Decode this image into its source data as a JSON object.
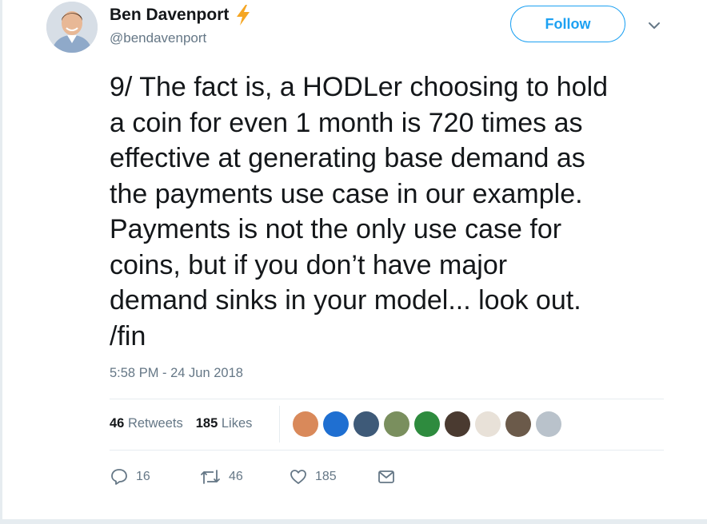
{
  "author": {
    "name": "Ben Davenport",
    "handle": "@bendavenport",
    "badge_icon": "lightning-bolt-icon",
    "badge_color": "#f5a623"
  },
  "header": {
    "follow_label": "Follow",
    "menu_icon": "chevron-down-icon"
  },
  "tweet": {
    "text": "9/ The fact is, a HODLer choosing to hold\na coin for even 1 month is 720 times as\neffective at generating base demand as\nthe payments use case in our example.\nPayments is not the only use case for\ncoins, but if you don’t have major\ndemand sinks in your model... look out.\n/fin",
    "timestamp": "5:58 PM - 24 Jun 2018"
  },
  "stats": {
    "retweets_count": "46",
    "retweets_label": "Retweets",
    "likes_count": "185",
    "likes_label": "Likes"
  },
  "likers": [
    {
      "name": "liker-avatar-1",
      "color": "#d9895a"
    },
    {
      "name": "liker-avatar-2",
      "color": "#1f6fd1"
    },
    {
      "name": "liker-avatar-3",
      "color": "#3e5a78"
    },
    {
      "name": "liker-avatar-4",
      "color": "#7a8f5e"
    },
    {
      "name": "liker-avatar-5",
      "color": "#2e8b3e"
    },
    {
      "name": "liker-avatar-6",
      "color": "#4a3a30"
    },
    {
      "name": "liker-avatar-7",
      "color": "#e8e1d8"
    },
    {
      "name": "liker-avatar-8",
      "color": "#6b5a4a"
    },
    {
      "name": "liker-avatar-9",
      "color": "#b9c2cb"
    }
  ],
  "actions": {
    "replies": "16",
    "retweets": "46",
    "likes": "185"
  },
  "colors": {
    "accent": "#1da1f2",
    "text": "#14171a",
    "secondary": "#657786",
    "border": "#e6ecf0"
  }
}
